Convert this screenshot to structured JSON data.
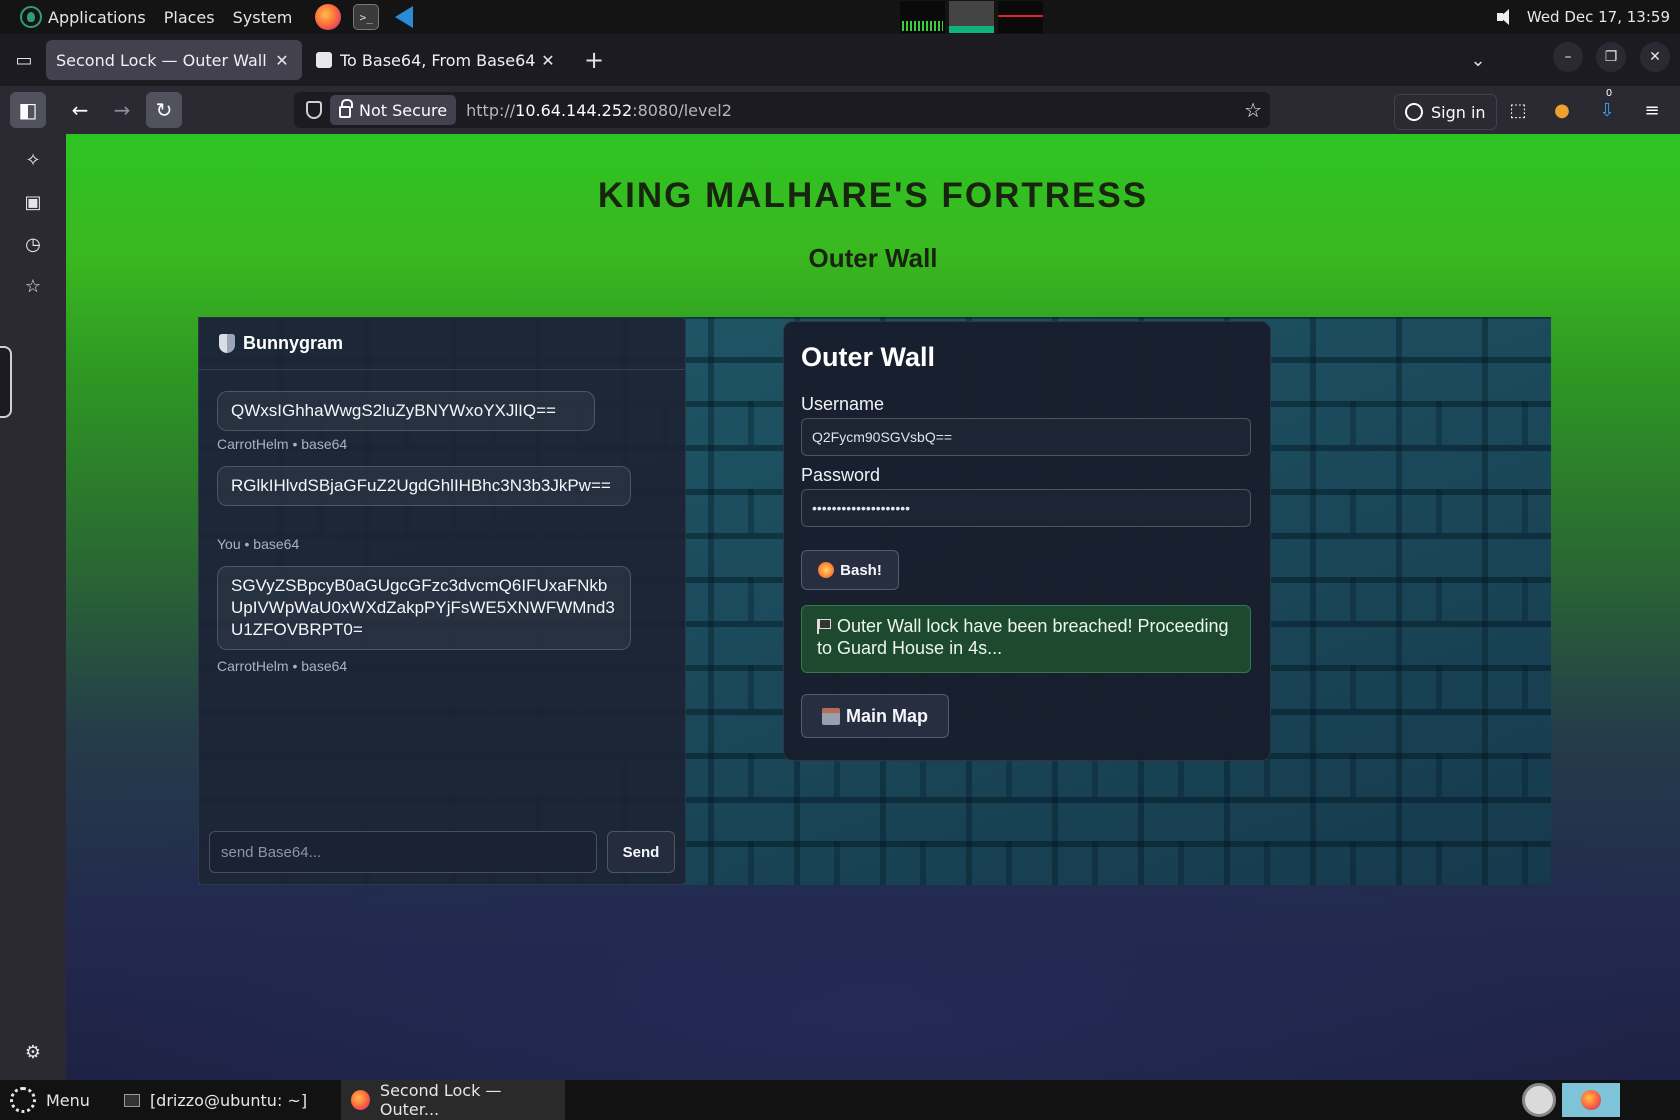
{
  "system_panel": {
    "menus": [
      "Applications",
      "Places",
      "System"
    ],
    "launchers": [
      "firefox-icon",
      "terminal-icon",
      "vscode-icon"
    ],
    "terminal_glyph": ">_",
    "datetime": "Wed Dec 17, 13:59"
  },
  "browser": {
    "tabs": [
      {
        "title": "Second Lock — Outer Wall",
        "active": true
      },
      {
        "title": "To Base64, From Base64 -",
        "active": false
      }
    ],
    "new_tab": "+",
    "close_glyph": "✕",
    "tab_list_glyph": "⌄",
    "window_controls": {
      "minimize": "–",
      "restore": "❐",
      "close": "✕"
    },
    "nav": {
      "back": "←",
      "forward": "→",
      "reload": "↻"
    },
    "security_label": "Not Secure",
    "url_prefix": "http://",
    "url_host": "10.64.144.252",
    "url_rest": ":8080/level2",
    "bookmark_glyph": "☆",
    "sign_in": "Sign in",
    "extension_badge": "0",
    "menu_glyph": "≡"
  },
  "sidebar": {
    "icons": [
      "ai-chat-icon",
      "synced-tabs-icon",
      "history-icon",
      "bookmarks-icon",
      "settings-icon"
    ],
    "glyphs": {
      "ai": "✧",
      "synced": "▣",
      "history": "◷",
      "bookmarks": "☆",
      "settings": "⚙"
    }
  },
  "page": {
    "title": "KING MALHARE'S FORTRESS",
    "subtitle": "Outer Wall",
    "chat": {
      "header": "Bunnygram",
      "messages": [
        {
          "text": "QWxsIGhhaWwgS2luZyBNYWxoYXJlIQ==",
          "meta": "CarrotHelm • base64"
        },
        {
          "text": "RGlkIHlvdSBjaGFuZ2UgdGhlIHBhc3N3b3JkPw==",
          "meta": "You • base64"
        },
        {
          "text": "SGVyZSBpcyB0aGUgcGFzc3dvcmQ6IFUxaFNkbUpIVWpWaU0xWXdZakpPYjFsWE5XNWFWMnd3U1ZFOVBRPT0=",
          "meta": "CarrotHelm • base64"
        }
      ],
      "input_placeholder": "send Base64...",
      "send_label": "Send"
    },
    "login": {
      "title": "Outer Wall",
      "username_label": "Username",
      "username_value": "Q2Fycm90SGVsbQ==",
      "password_label": "Password",
      "password_value": "••••••••••••••••••••",
      "bash_label": "Bash!",
      "alert_text": "Outer Wall lock have been breached! Proceeding to Guard House in 4s...",
      "main_map_label": "Main Map"
    }
  },
  "taskbar": {
    "menu_label": "Menu",
    "items": [
      "[drizzo@ubuntu: ~]",
      "Second Lock — Outer..."
    ]
  },
  "colors": {
    "page_green": "#2dc422",
    "alert_bg": "#1d4a2e",
    "panel_bg": "#1c2434"
  }
}
